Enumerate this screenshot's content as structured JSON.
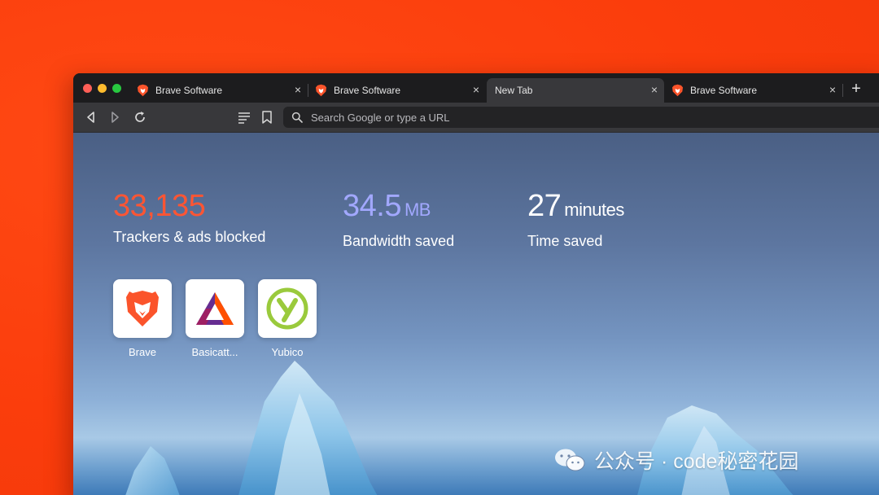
{
  "browser": {
    "tabs": [
      {
        "title": "Brave Software",
        "icon": "brave-lion-icon"
      },
      {
        "title": "Brave Software",
        "icon": "brave-lion-icon"
      },
      {
        "title": "New Tab",
        "icon": "",
        "active": true
      },
      {
        "title": "Brave Software",
        "icon": "brave-lion-icon"
      }
    ],
    "close_glyph": "×",
    "new_tab_glyph": "+",
    "toolbar": {
      "search_placeholder": "Search Google or type a URL"
    }
  },
  "new_tab_page": {
    "stats": [
      {
        "value": "33,135",
        "unit": "",
        "label": "Trackers & ads blocked",
        "color": "#ff5533"
      },
      {
        "value": "34.5",
        "unit": "MB",
        "label": "Bandwidth saved",
        "color": "#a2a8ff"
      },
      {
        "value": "27",
        "unit": "minutes",
        "label": "Time saved",
        "color": "#ffffff"
      }
    ],
    "top_sites": [
      {
        "label": "Brave",
        "icon": "brave-lion-icon"
      },
      {
        "label": "Basicatt...",
        "icon": "bat-triangle-icon"
      },
      {
        "label": "Yubico",
        "icon": "yubico-icon"
      }
    ]
  },
  "watermark": {
    "text": "公众号 · code秘密花园",
    "icon": "wechat-icon"
  },
  "colors": {
    "page_background": "#fb3d0c",
    "tabstrip": "#1c1c1e",
    "toolbar": "#38383b",
    "brave_orange": "#fb542b"
  }
}
